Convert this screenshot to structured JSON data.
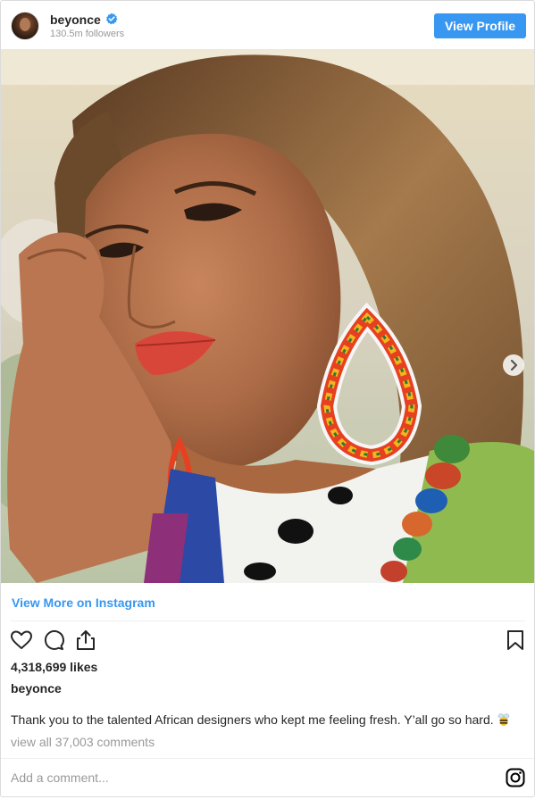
{
  "header": {
    "username": "beyonce",
    "followers": "130.5m followers",
    "view_profile_label": "View Profile",
    "verified_icon": "verified-badge-icon"
  },
  "post": {
    "view_more_label": "View More on Instagram",
    "likes": "4,318,699 likes",
    "owner": "beyonce",
    "caption": "Thank you to the talented African designers who kept me feeling fresh. Y’all go so hard.",
    "caption_emoji": "bee-emoji-icon",
    "view_comments": "view all 37,003 comments",
    "comment_placeholder": "Add a comment..."
  },
  "actions": {
    "icons": [
      "heart-icon",
      "comment-icon",
      "share-icon",
      "bookmark-icon"
    ]
  },
  "colors": {
    "accent": "#3897f0",
    "text": "#262626",
    "muted": "#999999",
    "border": "#dbdbdb"
  }
}
